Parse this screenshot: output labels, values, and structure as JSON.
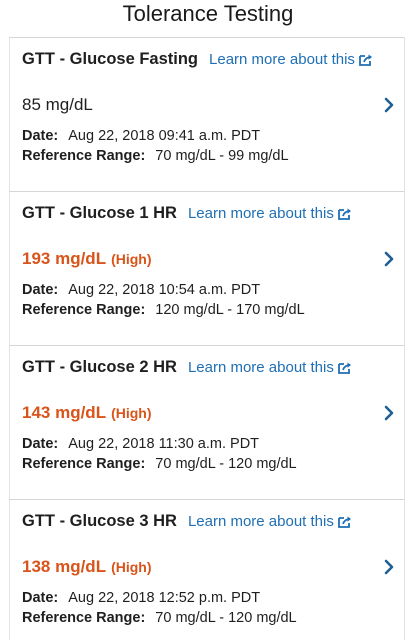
{
  "page_title": "Tolerance Testing",
  "icons": {
    "external": "external-link-icon",
    "chevron": "chevron-right-icon"
  },
  "colors": {
    "link": "#1f6fb5",
    "high": "#d9541a",
    "chevron": "#1f5f95"
  },
  "tests": [
    {
      "name": "GTT - Glucose Fasting",
      "link": "Learn more about this",
      "value": "85 mg/dL",
      "flag": "",
      "status": "normal",
      "date_label": "Date:",
      "date": "Aug 22, 2018 09:41 a.m. PDT",
      "range_label": "Reference Range:",
      "range": "70 mg/dL - 99 mg/dL"
    },
    {
      "name": "GTT - Glucose 1 HR",
      "link": "Learn more about this",
      "value": "193 mg/dL",
      "flag": "(High)",
      "status": "high",
      "date_label": "Date:",
      "date": "Aug 22, 2018 10:54 a.m. PDT",
      "range_label": "Reference Range:",
      "range": "120 mg/dL - 170 mg/dL"
    },
    {
      "name": "GTT - Glucose 2 HR",
      "link": "Learn more about this",
      "value": "143 mg/dL",
      "flag": "(High)",
      "status": "high",
      "date_label": "Date:",
      "date": "Aug 22, 2018 11:30 a.m. PDT",
      "range_label": "Reference Range:",
      "range": "70 mg/dL - 120 mg/dL"
    },
    {
      "name": "GTT - Glucose 3 HR",
      "link": "Learn more about this",
      "value": "138 mg/dL",
      "flag": "(High)",
      "status": "high",
      "date_label": "Date:",
      "date": "Aug 22, 2018 12:52 p.m. PDT",
      "range_label": "Reference Range:",
      "range": "70 mg/dL - 120 mg/dL"
    }
  ]
}
